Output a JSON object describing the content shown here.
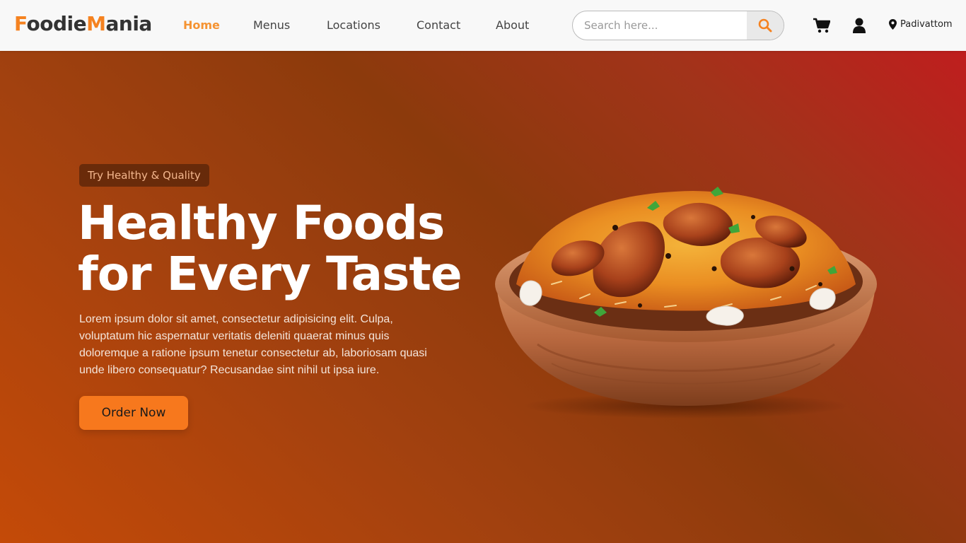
{
  "brand": {
    "part1_accent": "F",
    "part1_rest": "oodie",
    "part2_accent": "M",
    "part2_rest": "ania"
  },
  "nav": [
    {
      "label": "Home",
      "active": true
    },
    {
      "label": "Menus",
      "active": false
    },
    {
      "label": "Locations",
      "active": false
    },
    {
      "label": "Contact",
      "active": false
    },
    {
      "label": "About",
      "active": false
    }
  ],
  "search": {
    "placeholder": "Search here...",
    "value": ""
  },
  "location": {
    "label": "Padivattom"
  },
  "hero": {
    "badge": "Try Healthy & Quality",
    "title_line1": "Healthy Foods",
    "title_line2": "for Every Taste",
    "description": "Lorem ipsum dolor sit amet, consectetur adipisicing elit. Culpa, voluptatum hic aspernatur veritatis deleniti quaerat minus quis doloremque a ratione ipsum tenetur consectetur ab, laboriosam quasi unde libero consequatur? Recusandae sint nihil ut ipsa iure.",
    "cta": "Order Now"
  },
  "icons": {
    "search": "search-icon",
    "cart": "cart-icon",
    "user": "user-icon",
    "location": "location-pin-icon"
  },
  "colors": {
    "accent": "#f58220",
    "cta": "#f7781d",
    "nav_active": "#f59332",
    "hero_dark": "#8c3a0c",
    "hero_red": "#bf1e1e"
  }
}
